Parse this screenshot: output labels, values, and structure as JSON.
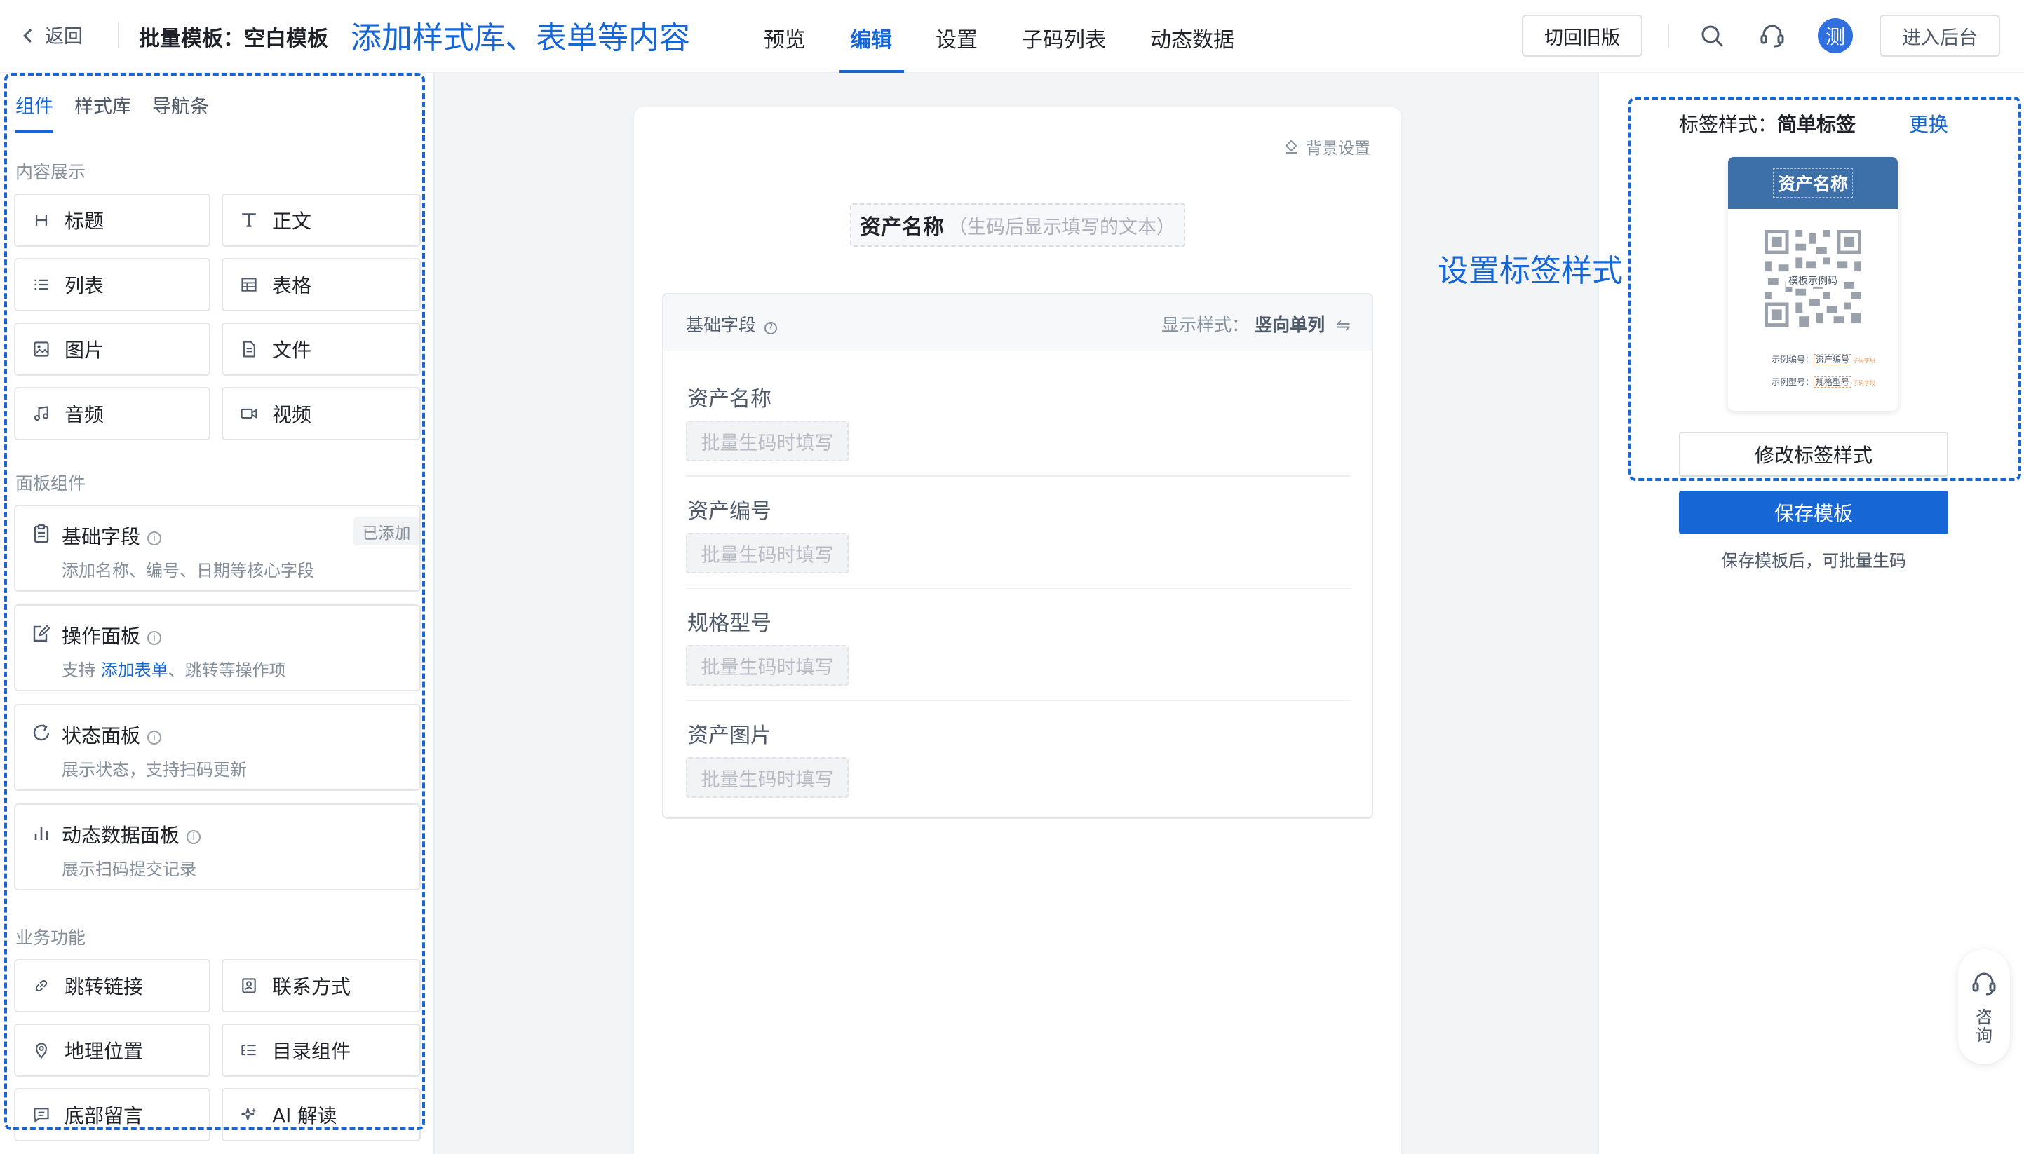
{
  "header": {
    "back_label": "返回",
    "template_title": "批量模板：空白模板",
    "nav": [
      "预览",
      "编辑",
      "设置",
      "子码列表",
      "动态数据"
    ],
    "active_nav": "编辑",
    "switch_old_label": "切回旧版",
    "avatar_text": "测",
    "admin_label": "进入后台"
  },
  "annotations": {
    "left": "添加样式库、表单等内容",
    "right": "设置标签样式"
  },
  "left": {
    "tabs": [
      "组件",
      "样式库",
      "导航条"
    ],
    "active_tab": "组件",
    "section_content": "内容展示",
    "content_items": [
      {
        "label": "标题",
        "icon": "heading-icon"
      },
      {
        "label": "正文",
        "icon": "text-icon"
      },
      {
        "label": "列表",
        "icon": "list-icon"
      },
      {
        "label": "表格",
        "icon": "table-icon"
      },
      {
        "label": "图片",
        "icon": "image-icon"
      },
      {
        "label": "文件",
        "icon": "file-icon"
      },
      {
        "label": "音频",
        "icon": "audio-icon"
      },
      {
        "label": "视频",
        "icon": "video-icon"
      }
    ],
    "section_panels": "面板组件",
    "panels": [
      {
        "title": "基础字段",
        "desc": "添加名称、编号、日期等核心字段",
        "badge": "已添加",
        "icon": "clipboard-icon"
      },
      {
        "title": "操作面板",
        "desc_prefix": "支持 ",
        "desc_link": "添加表单",
        "desc_suffix": "、跳转等操作项",
        "icon": "edit-icon"
      },
      {
        "title": "状态面板",
        "desc": "展示状态，支持扫码更新",
        "icon": "refresh-icon"
      },
      {
        "title": "动态数据面板",
        "desc": "展示扫码提交记录",
        "icon": "bar-chart-icon"
      }
    ],
    "section_business": "业务功能",
    "business_items": [
      {
        "label": "跳转链接",
        "icon": "link-icon"
      },
      {
        "label": "联系方式",
        "icon": "contact-icon"
      },
      {
        "label": "地理位置",
        "icon": "location-icon"
      },
      {
        "label": "目录组件",
        "icon": "catalog-icon"
      },
      {
        "label": "底部留言",
        "icon": "message-icon"
      },
      {
        "label": "AI 解读",
        "icon": "sparkle-icon"
      }
    ]
  },
  "canvas": {
    "bg_setting": "背景设置",
    "asset_title": "资产名称",
    "asset_title_hint": "（生码后显示填写的文本）",
    "field_header": "基础字段",
    "display_style_label": "显示样式：",
    "display_style_value": "竖向单列",
    "fields": [
      {
        "label": "资产名称",
        "placeholder": "批量生码时填写"
      },
      {
        "label": "资产编号",
        "placeholder": "批量生码时填写"
      },
      {
        "label": "规格型号",
        "placeholder": "批量生码时填写"
      },
      {
        "label": "资产图片",
        "placeholder": "批量生码时填写"
      }
    ]
  },
  "right": {
    "label_style_prefix": "标签样式：",
    "label_style_value": "简单标签",
    "change_label": "更换",
    "preview": {
      "head": "资产名称",
      "qr_text": "模板示例码",
      "row1_label": "示例编号：",
      "row1_value": "资产编号",
      "row2_label": "示例型号：",
      "row2_value": "规格型号",
      "tag": "子码字段"
    },
    "modify_label": "修改标签样式",
    "save_label": "保存模板",
    "save_hint": "保存模板后，可批量生码",
    "consult_label": "咨询"
  },
  "colors": {
    "accent": "#1766d6",
    "label_head": "#3d6fa8"
  }
}
